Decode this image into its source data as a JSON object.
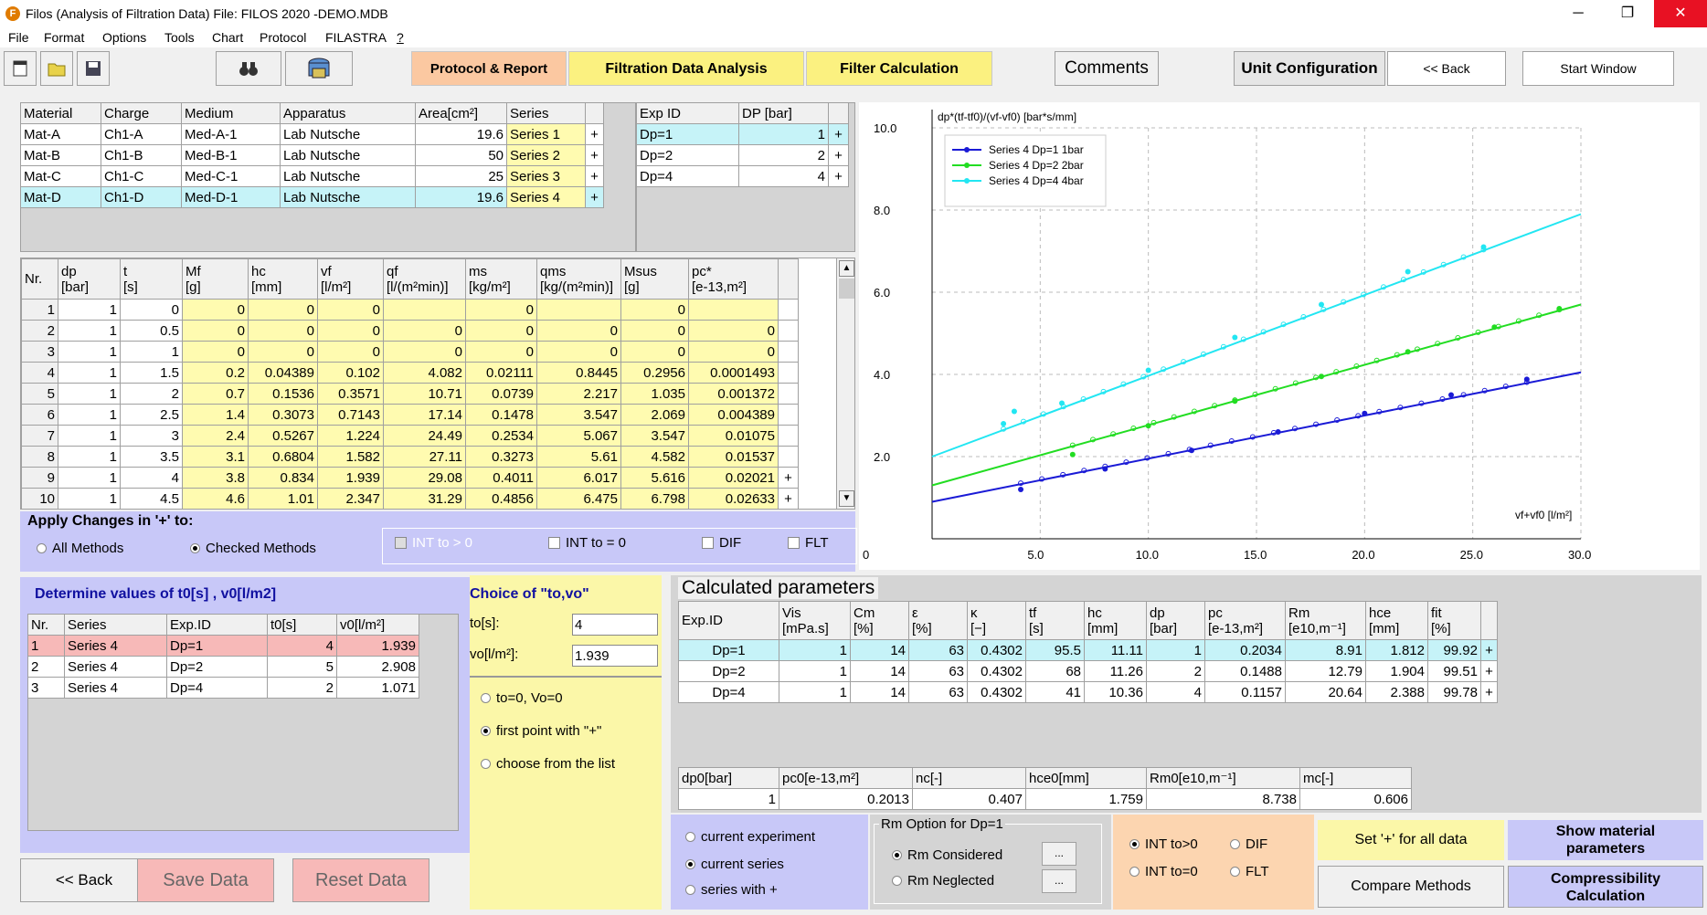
{
  "window": {
    "title": "Filos (Analysis of Filtration Data)   File: FILOS 2020 -DEMO.MDB",
    "app_icon": "F",
    "minimize": "─",
    "restore": "❐",
    "close": "✕"
  },
  "menu": [
    "File",
    "Format",
    "Options",
    "Tools",
    "Chart",
    "Protocol",
    "FILASTRA",
    "?"
  ],
  "toolbar": {
    "protocol": "Protocol & Report",
    "fda": "Filtration Data Analysis",
    "filter": "Filter Calculation",
    "comments": "Comments",
    "unit": "Unit Configuration",
    "back": "<< Back",
    "start": "Start Window"
  },
  "materials": {
    "headers": [
      "Material",
      "Charge",
      "Medium",
      "Apparatus",
      "Area[cm²]",
      "Series"
    ],
    "rows": [
      [
        "Mat-A",
        "Ch1-A",
        "Med-A-1",
        "Lab Nutsche",
        "19.6",
        "Series 1",
        "+"
      ],
      [
        "Mat-B",
        "Ch1-B",
        "Med-B-1",
        "Lab  Nutsche",
        "50",
        "Series 2",
        "+"
      ],
      [
        "Mat-C",
        "Ch1-C",
        "Med-C-1",
        "Lab  Nutsche",
        "25",
        "Series 3",
        "+"
      ],
      [
        "Mat-D",
        "Ch1-D",
        "Med-D-1",
        "Lab Nutsche",
        "19.6",
        "Series 4",
        "+"
      ]
    ],
    "selected": 3
  },
  "experiments": {
    "headers": [
      "Exp ID",
      "DP [bar]"
    ],
    "rows": [
      [
        "Dp=1",
        "1",
        "+"
      ],
      [
        "Dp=2",
        "2",
        "+"
      ],
      [
        "Dp=4",
        "4",
        "+"
      ]
    ],
    "selected": 0
  },
  "data": {
    "headers": [
      "Nr.",
      "dp\n[bar]",
      "t\n[s]",
      "Mf\n[g]",
      "hc\n[mm]",
      "vf\n[l/m²]",
      "qf\n[l/(m²min)]",
      "ms\n[kg/m²]",
      "qms\n[kg/(m²min)]",
      "Msus\n[g]",
      "pc*\n[e-13,m²]"
    ],
    "rows": [
      [
        "1",
        "1",
        "0",
        "0",
        "0",
        "0",
        "",
        "0",
        "",
        "0",
        "",
        ""
      ],
      [
        "2",
        "1",
        "0.5",
        "0",
        "0",
        "0",
        "0",
        "0",
        "0",
        "0",
        "0",
        ""
      ],
      [
        "3",
        "1",
        "1",
        "0",
        "0",
        "0",
        "0",
        "0",
        "0",
        "0",
        "0",
        ""
      ],
      [
        "4",
        "1",
        "1.5",
        "0.2",
        "0.04389",
        "0.102",
        "4.082",
        "0.02111",
        "0.8445",
        "0.2956",
        "0.0001493",
        ""
      ],
      [
        "5",
        "1",
        "2",
        "0.7",
        "0.1536",
        "0.3571",
        "10.71",
        "0.0739",
        "2.217",
        "1.035",
        "0.001372",
        ""
      ],
      [
        "6",
        "1",
        "2.5",
        "1.4",
        "0.3073",
        "0.7143",
        "17.14",
        "0.1478",
        "3.547",
        "2.069",
        "0.004389",
        ""
      ],
      [
        "7",
        "1",
        "3",
        "2.4",
        "0.5267",
        "1.224",
        "24.49",
        "0.2534",
        "5.067",
        "3.547",
        "0.01075",
        ""
      ],
      [
        "8",
        "1",
        "3.5",
        "3.1",
        "0.6804",
        "1.582",
        "27.11",
        "0.3273",
        "5.61",
        "4.582",
        "0.01537",
        ""
      ],
      [
        "9",
        "1",
        "4",
        "3.8",
        "0.834",
        "1.939",
        "29.08",
        "0.4011",
        "6.017",
        "5.616",
        "0.02021",
        "+"
      ],
      [
        "10",
        "1",
        "4.5",
        "4.6",
        "1.01",
        "2.347",
        "31.29",
        "0.4856",
        "6.475",
        "6.798",
        "0.02633",
        "+"
      ]
    ]
  },
  "apply": {
    "title": "Apply Changes in '+' to:",
    "all": "All Methods",
    "checked": "Checked Methods",
    "int_gt": "INT to > 0",
    "int_eq": "INT to = 0",
    "dif": "DIF",
    "flt": "FLT"
  },
  "determine": {
    "title": "Determine values of t0[s] , v0[l/m2]",
    "headers": [
      "Nr.",
      "Series",
      "Exp.ID",
      "t0[s]",
      "v0[l/m²]"
    ],
    "rows": [
      [
        "1",
        "Series 4",
        "Dp=1",
        "4",
        "1.939"
      ],
      [
        "2",
        "Series 4",
        "Dp=2",
        "5",
        "2.908"
      ],
      [
        "3",
        "Series 4",
        "Dp=4",
        "2",
        "1.071"
      ]
    ]
  },
  "choice": {
    "title": "Choice of  \"to,vo\"",
    "to_label": "to[s]:",
    "to_value": "4",
    "vo_label": "vo[l/m²]:",
    "vo_value": "1.939",
    "opt1": "to=0,  Vo=0",
    "opt2": "first point with \"+\"",
    "opt3": "choose from the list"
  },
  "calc": {
    "title": "Calculated parameters",
    "headers": [
      "Exp.ID",
      "Vis\n[mPa.s]",
      "Cm\n[%]",
      "ε\n[%]",
      "κ\n[−]",
      "tf\n[s]",
      "hc\n[mm]",
      "dp\n[bar]",
      "pc\n[e-13,m²]",
      "Rm\n[e10,m⁻¹]",
      "hce\n[mm]",
      "fit\n[%]"
    ],
    "rows": [
      [
        "Dp=1",
        "1",
        "14",
        "63",
        "0.4302",
        "95.5",
        "11.11",
        "1",
        "0.2034",
        "8.91",
        "1.812",
        "99.92",
        "+"
      ],
      [
        "Dp=2",
        "1",
        "14",
        "63",
        "0.4302",
        "68",
        "11.26",
        "2",
        "0.1488",
        "12.79",
        "1.904",
        "99.51",
        "+"
      ],
      [
        "Dp=4",
        "1",
        "14",
        "63",
        "0.4302",
        "41",
        "10.36",
        "4",
        "0.1157",
        "20.64",
        "2.388",
        "99.78",
        "+"
      ]
    ]
  },
  "compress": {
    "headers": [
      "dp0[bar]",
      "pc0[e-13,m²]",
      "nc[-]",
      "hce0[mm]",
      "Rm0[e10,m⁻¹]",
      "mc[-]"
    ],
    "values": [
      "1",
      "0.2013",
      "0.407",
      "1.759",
      "8.738",
      "0.606"
    ]
  },
  "scope": {
    "cur_exp": "current experiment",
    "cur_series": "current series",
    "series_plus": "series with +"
  },
  "rm": {
    "title": "Rm Option for Dp=1",
    "considered": "Rm Considered",
    "neglected": "Rm Neglected",
    "dots": "..."
  },
  "int": {
    "gt": "INT to>0",
    "eq": "INT to=0",
    "dif": "DIF",
    "flt": "FLT"
  },
  "buttons": {
    "set_plus": "Set '+' for all data",
    "compare": "Compare Methods",
    "show_mat": "Show material\nparameters",
    "compress": "Compressibility\nCalculation",
    "back": "<< Back",
    "save": "Save Data",
    "reset": "Reset Data"
  },
  "chart_data": {
    "type": "scatter",
    "ylabel": "dp*(tf-tf0)/(vf-vf0) [bar*s/mm]",
    "xlabel": "vf+vf0 [l/m²]",
    "xlim": [
      0,
      30
    ],
    "ylim": [
      0,
      10
    ],
    "xticks": [
      "0",
      "5.0",
      "10.0",
      "15.0",
      "20.0",
      "25.0",
      "30.0"
    ],
    "yticks": [
      "2.0",
      "4.0",
      "6.0",
      "8.0",
      "10.0"
    ],
    "series": [
      {
        "name": "Series 4  Dp=1  1bar",
        "color": "#1a1ad6",
        "line": [
          [
            0,
            0.9
          ],
          [
            30,
            4.05
          ]
        ],
        "points": [
          [
            4.1,
            1.2
          ],
          [
            8,
            1.7
          ],
          [
            12,
            2.15
          ],
          [
            16,
            2.6
          ],
          [
            20,
            3.05
          ],
          [
            24,
            3.5
          ],
          [
            27.5,
            3.88
          ]
        ]
      },
      {
        "name": "Series 4  Dp=2  2bar",
        "color": "#22dd22",
        "line": [
          [
            0,
            1.3
          ],
          [
            30,
            5.7
          ]
        ],
        "points": [
          [
            6.5,
            2.05
          ],
          [
            10,
            2.75
          ],
          [
            14,
            3.35
          ],
          [
            18,
            3.95
          ],
          [
            22,
            4.55
          ],
          [
            26,
            5.15
          ],
          [
            29,
            5.6
          ]
        ]
      },
      {
        "name": "Series 4  Dp=4  4bar",
        "color": "#22e6f2",
        "line": [
          [
            0,
            2.0
          ],
          [
            30,
            7.9
          ]
        ],
        "points": [
          [
            3.3,
            2.8
          ],
          [
            3.8,
            3.1
          ],
          [
            6,
            3.3
          ],
          [
            10,
            4.1
          ],
          [
            14,
            4.9
          ],
          [
            18,
            5.7
          ],
          [
            22,
            6.5
          ],
          [
            25.5,
            7.1
          ]
        ]
      }
    ],
    "legend": "top-left"
  }
}
